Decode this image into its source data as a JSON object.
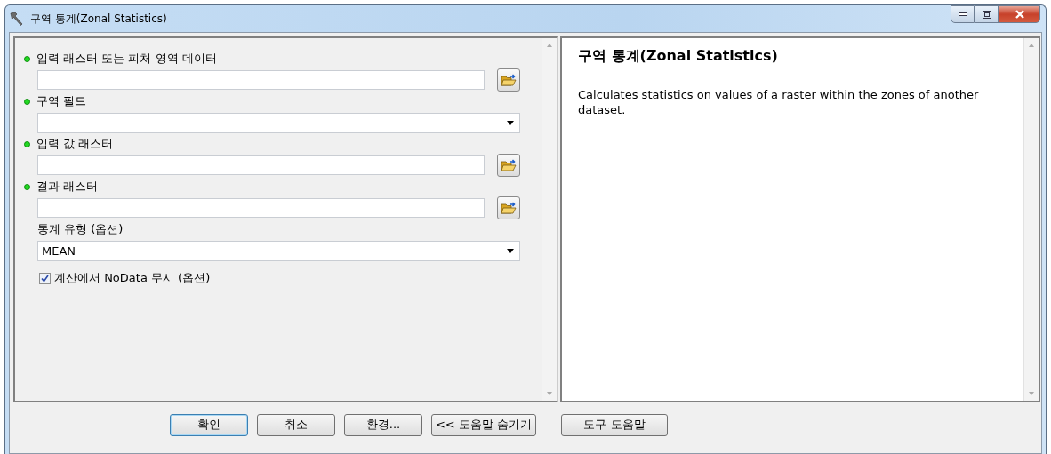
{
  "window": {
    "title": "구역 통계(Zonal Statistics)"
  },
  "parameters": [
    {
      "kind": "browse",
      "label": "입력 래스터 또는 피처 영역 데이터",
      "required": true
    },
    {
      "kind": "dropdown",
      "label": "구역 필드",
      "required": true
    },
    {
      "kind": "browse",
      "label": "입력 값 래스터",
      "required": true
    },
    {
      "kind": "browse",
      "label": "결과 래스터",
      "required": true
    },
    {
      "kind": "dropdown",
      "label": "통계 유형 (옵션)",
      "required": false,
      "value": "MEAN"
    },
    {
      "kind": "checkbox",
      "label": "계산에서 NoData 무시 (옵션)",
      "checked": true
    }
  ],
  "help": {
    "title": "구역 통계(Zonal Statistics)",
    "description": "Calculates statistics on values of a raster within the zones of another dataset."
  },
  "buttons": [
    {
      "label": "확인",
      "default": true
    },
    {
      "label": "취소",
      "default": false
    },
    {
      "label": "환경...",
      "default": false
    },
    {
      "label": "<< 도움말 숨기기",
      "default": false
    },
    {
      "label": "도구 도움말",
      "default": false
    }
  ]
}
